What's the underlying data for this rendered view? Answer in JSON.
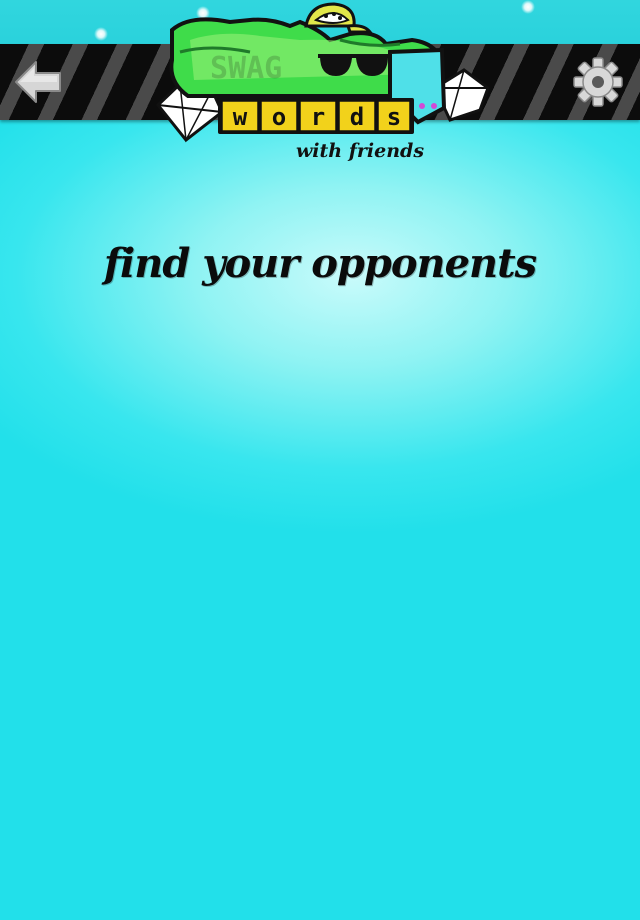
{
  "app": {
    "logo": {
      "brand_word": "SWAG",
      "tile_letters": [
        "w",
        "o",
        "r",
        "d",
        "s"
      ],
      "tagline": "with friends"
    }
  },
  "header": {
    "back_icon": "left-arrow-icon",
    "settings_icon": "gear-icon"
  },
  "main": {
    "heading": "find your opponents"
  },
  "colors": {
    "background": "#22e0ea",
    "nav_stripe_dark": "#0c0c0c",
    "nav_stripe_light": "#4a4a4a",
    "tile_yellow": "#f2d21b",
    "logo_green": "#3fdc4a",
    "icon_silver": "#d8d8d8"
  }
}
